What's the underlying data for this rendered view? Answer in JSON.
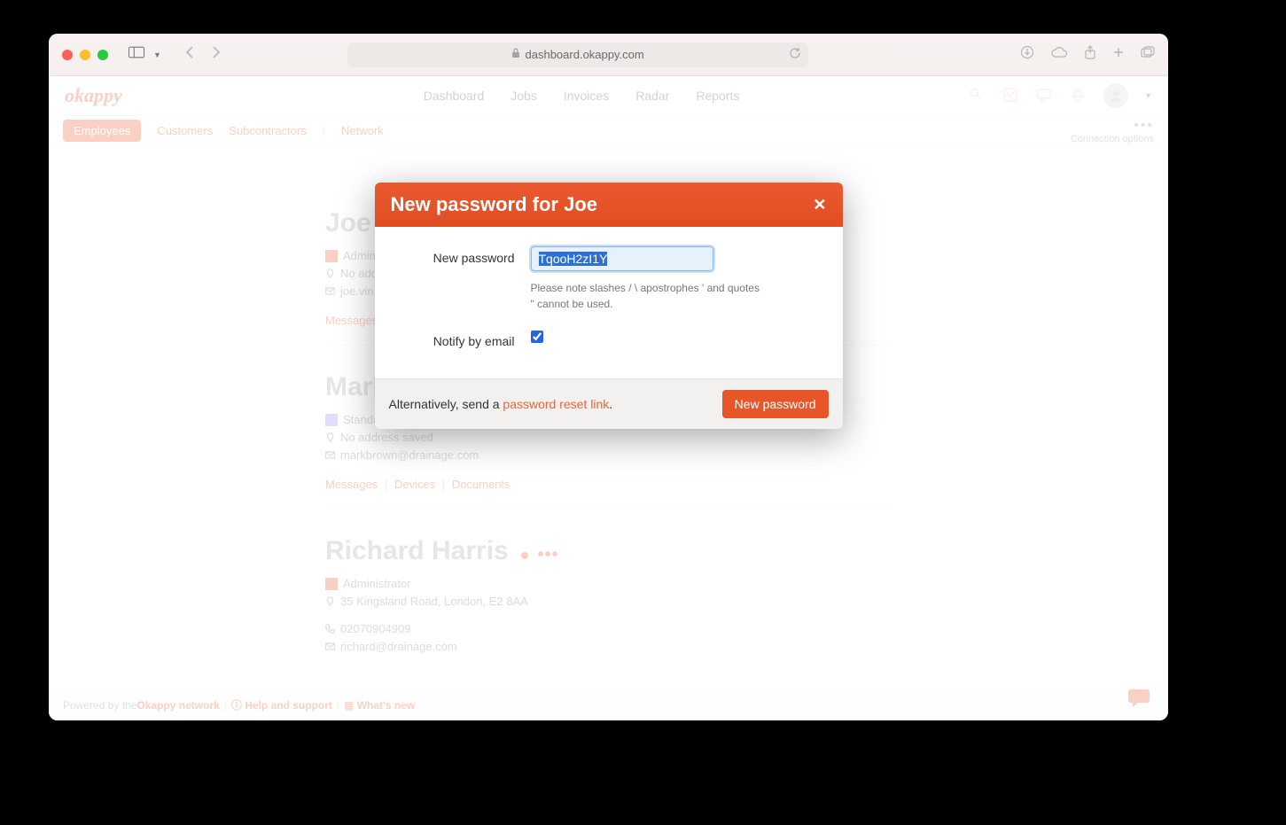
{
  "browser": {
    "url_host": "dashboard.okappy.com"
  },
  "header": {
    "logo": "okappy",
    "nav": {
      "dashboard": "Dashboard",
      "jobs": "Jobs",
      "invoices": "Invoices",
      "radar": "Radar",
      "reports": "Reports"
    }
  },
  "tabs": {
    "employees": "Employees",
    "customers": "Customers",
    "subcontractors": "Subcontractors",
    "network": "Network",
    "connection_options": "Connection options"
  },
  "employees": [
    {
      "name": "Joe",
      "role": "Administrator",
      "role_type": "admin",
      "address": "No address saved",
      "email": "joe.vin",
      "links": [
        "Messages"
      ]
    },
    {
      "name": "Mark Brown",
      "role": "Standard user",
      "role_type": "standard",
      "address": "No address saved",
      "email": "markbrown@drainage.com",
      "links": [
        "Messages",
        "Devices",
        "Documents"
      ]
    },
    {
      "name": "Richard Harris",
      "role": "Administrator",
      "role_type": "admin",
      "address": "35 Kingsland Road, London, E2 8AA",
      "phone": "02070904909",
      "email": "richard@drainage.com",
      "links": []
    }
  ],
  "modal": {
    "title": "New password for Joe",
    "password_label": "New password",
    "password_value": "TqooH2zI1Y",
    "hint": "Please note slashes / \\ apostrophes ' and quotes \" cannot be used.",
    "notify_label": "Notify by email",
    "notify_checked": true,
    "alt_prefix": "Alternatively, send a ",
    "alt_link": "password reset link",
    "alt_suffix": ".",
    "submit": "New password"
  },
  "footer": {
    "powered_prefix": "Powered by the ",
    "powered_link": "Okappy network",
    "help": "Help and support",
    "whatsnew": "What's new"
  }
}
